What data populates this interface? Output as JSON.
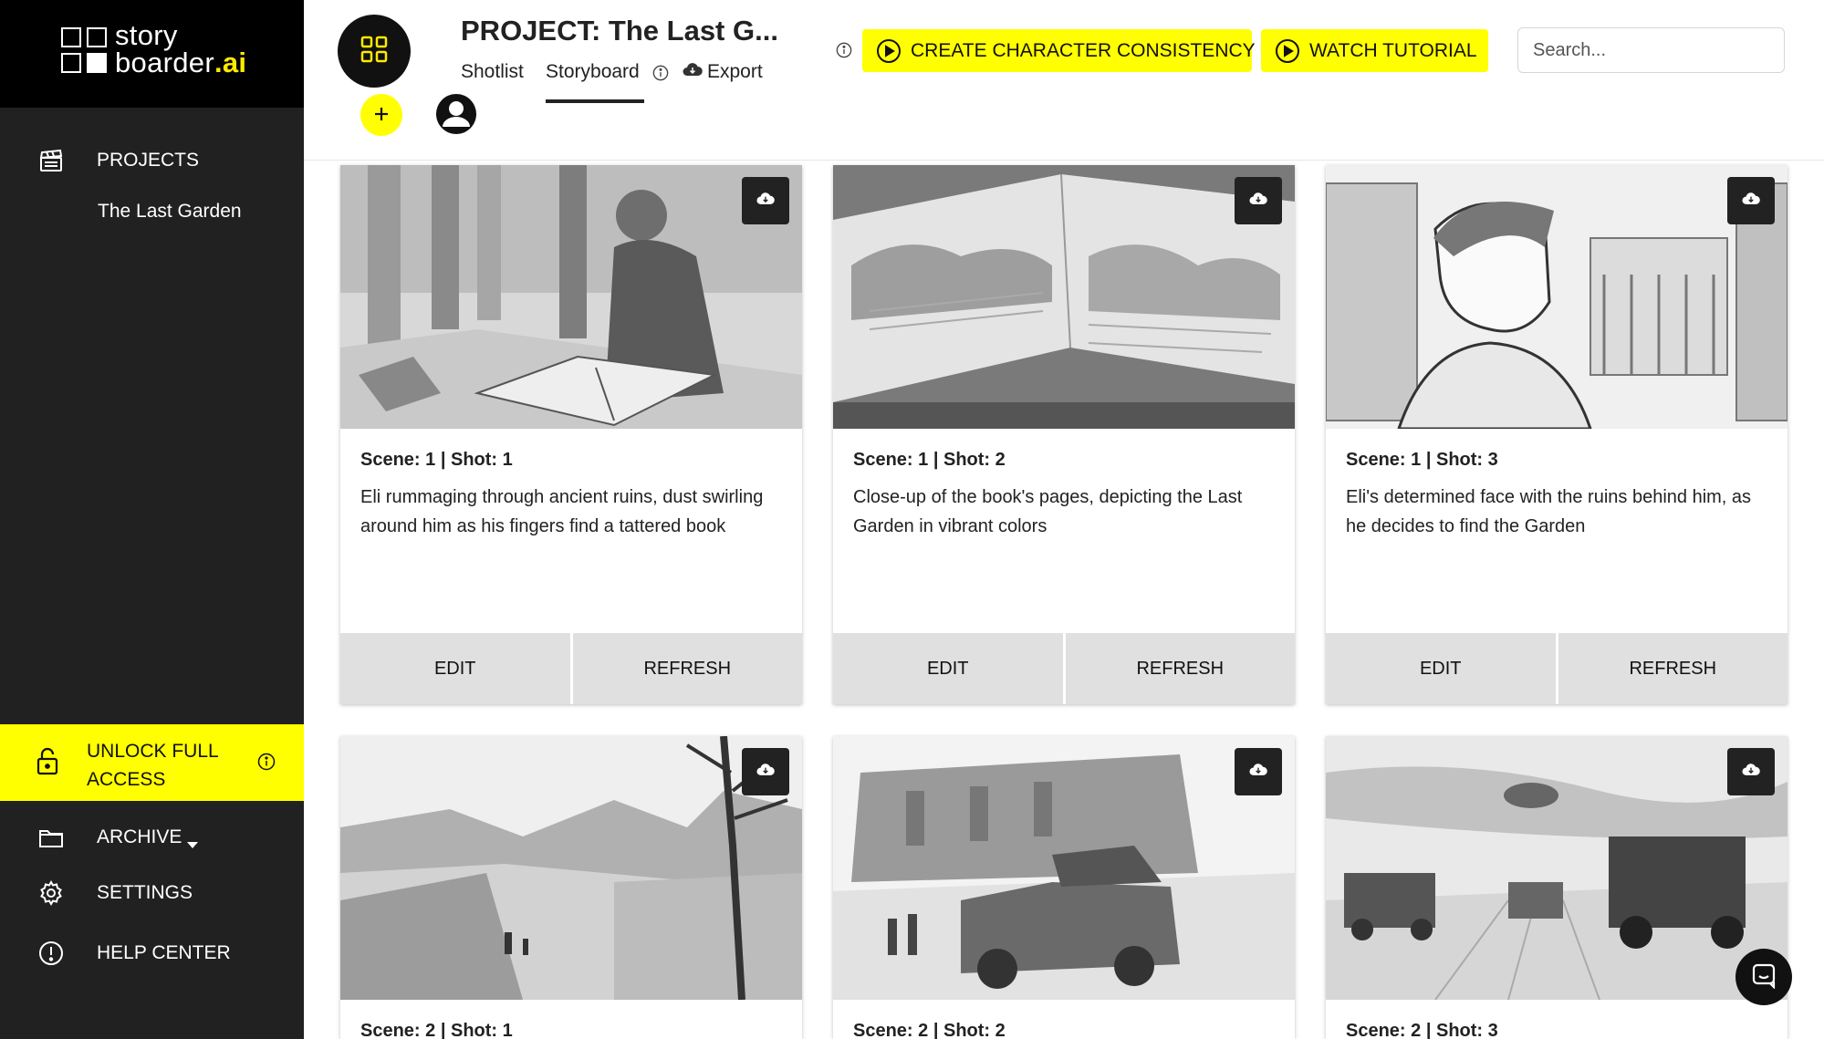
{
  "logo": {
    "line1": "story",
    "line2": "boarder",
    "ai": ".ai"
  },
  "sidebar": {
    "projects_label": "PROJECTS",
    "current_project": "The Last Garden",
    "unlock_label": "UNLOCK FULL ACCESS",
    "archive_label": "ARCHIVE",
    "settings_label": "SETTINGS",
    "help_label": "HELP CENTER"
  },
  "header": {
    "title": "PROJECT: The Last G...",
    "tabs": [
      {
        "label": "Shotlist"
      },
      {
        "label": "Storyboard",
        "active": true
      },
      {
        "label": "Export"
      }
    ],
    "consistency_button": "CREATE CHARACTER CONSISTENCY",
    "tutorial_button": "WATCH TUTORIAL",
    "search_placeholder": "Search...",
    "plus_label": "+"
  },
  "cards": [
    {
      "shot": "Scene: 1 | Shot: 1",
      "description": "Eli rummaging through ancient ruins, dust swirling around him as his fingers find a tattered book",
      "edit": "EDIT",
      "refresh": "REFRESH"
    },
    {
      "shot": "Scene: 1 | Shot: 2",
      "description": "Close-up of the book's pages, depicting the Last Garden in vibrant colors",
      "edit": "EDIT",
      "refresh": "REFRESH"
    },
    {
      "shot": "Scene: 1 | Shot: 3",
      "description": "Eli's determined face with the ruins behind him, as he decides to find the Garden",
      "edit": "EDIT",
      "refresh": "REFRESH"
    },
    {
      "shot": "Scene: 2 | Shot: 1",
      "description": "",
      "edit": "",
      "refresh": ""
    },
    {
      "shot": "Scene: 2 | Shot: 2",
      "description": "",
      "edit": "",
      "refresh": ""
    },
    {
      "shot": "Scene: 2 | Shot: 3",
      "description": "",
      "edit": "",
      "refresh": ""
    }
  ],
  "colors": {
    "accent": "#ffff00",
    "sidebar": "#212121",
    "logo_bg": "#000000"
  },
  "icons": [
    "clapperboard-icon",
    "lock-icon",
    "info-icon",
    "folder-icon",
    "caret-down-icon",
    "gear-icon",
    "alert-circle-icon",
    "grid-icon",
    "plus-icon",
    "user-avatar-icon",
    "cloud-icon",
    "play-circle-icon",
    "chat-icon",
    "cloud-download-icon"
  ]
}
